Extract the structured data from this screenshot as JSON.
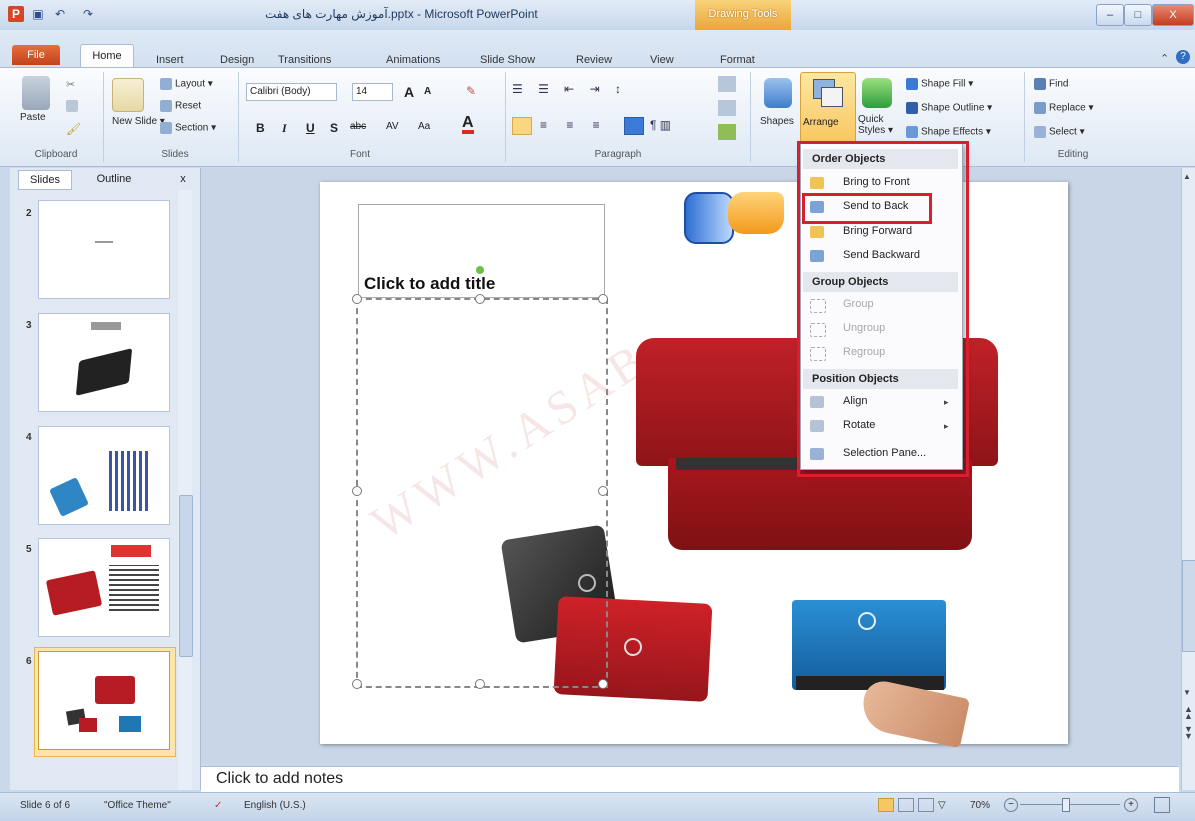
{
  "window": {
    "title": "آموزش مهارت های هفت.pptx - Microsoft PowerPoint",
    "contextual_tab": "Drawing Tools",
    "minimize": "–",
    "maximize": "□",
    "close": "X"
  },
  "qat": {
    "app_icon": "P",
    "save": "▣",
    "undo": "↶",
    "redo": "↷"
  },
  "tabs": [
    "File",
    "Home",
    "Insert",
    "Design",
    "Transitions",
    "Animations",
    "Slide Show",
    "Review",
    "View",
    "Format"
  ],
  "ribbon": {
    "clipboard": {
      "paste": "Paste",
      "label": "Clipboard"
    },
    "slides": {
      "layout": "Layout ▾",
      "reset": "Reset",
      "new_slide": "New Slide ▾",
      "section": "Section ▾",
      "label": "Slides"
    },
    "font": {
      "font_name": "Calibri (Body)",
      "font_size": "14",
      "label": "Font",
      "bold": "B",
      "italic": "I",
      "underline": "U",
      "shadow": "S",
      "strike": "abc",
      "spacing": "AV",
      "case": "Aa",
      "grow": "A",
      "shrink": "A"
    },
    "paragraph": {
      "label": "Paragraph"
    },
    "drawing": {
      "shapes": "Shapes",
      "arrange": "Arrange",
      "quick_styles": "Quick Styles ▾",
      "shape_fill": "Shape Fill ▾",
      "shape_outline": "Shape Outline ▾",
      "shape_effects": "Shape Effects ▾"
    },
    "editing": {
      "find": "Find",
      "replace": "Replace ▾",
      "select": "Select ▾",
      "label": "Editing"
    }
  },
  "panel": {
    "tab_slides": "Slides",
    "tab_outline": "Outline",
    "close": "x",
    "slide_numbers": [
      "2",
      "3",
      "4",
      "5",
      "6"
    ]
  },
  "slide": {
    "title_placeholder": "Click to add title"
  },
  "notes": {
    "placeholder": "Click to add notes"
  },
  "arrange_menu": {
    "order_header": "Order Objects",
    "bring_to_front": "Bring to Front",
    "send_to_back": "Send to Back",
    "bring_forward": "Bring Forward",
    "send_backward": "Send Backward",
    "group_header": "Group Objects",
    "group": "Group",
    "ungroup": "Ungroup",
    "regroup": "Regroup",
    "position_header": "Position Objects",
    "align": "Align",
    "rotate": "Rotate",
    "selection_pane": "Selection Pane..."
  },
  "status": {
    "slide_info": "Slide 6 of 6",
    "theme": "\"Office Theme\"",
    "language": "English (U.S.)",
    "zoom": "70%"
  },
  "watermark": "WWW.ASAB"
}
